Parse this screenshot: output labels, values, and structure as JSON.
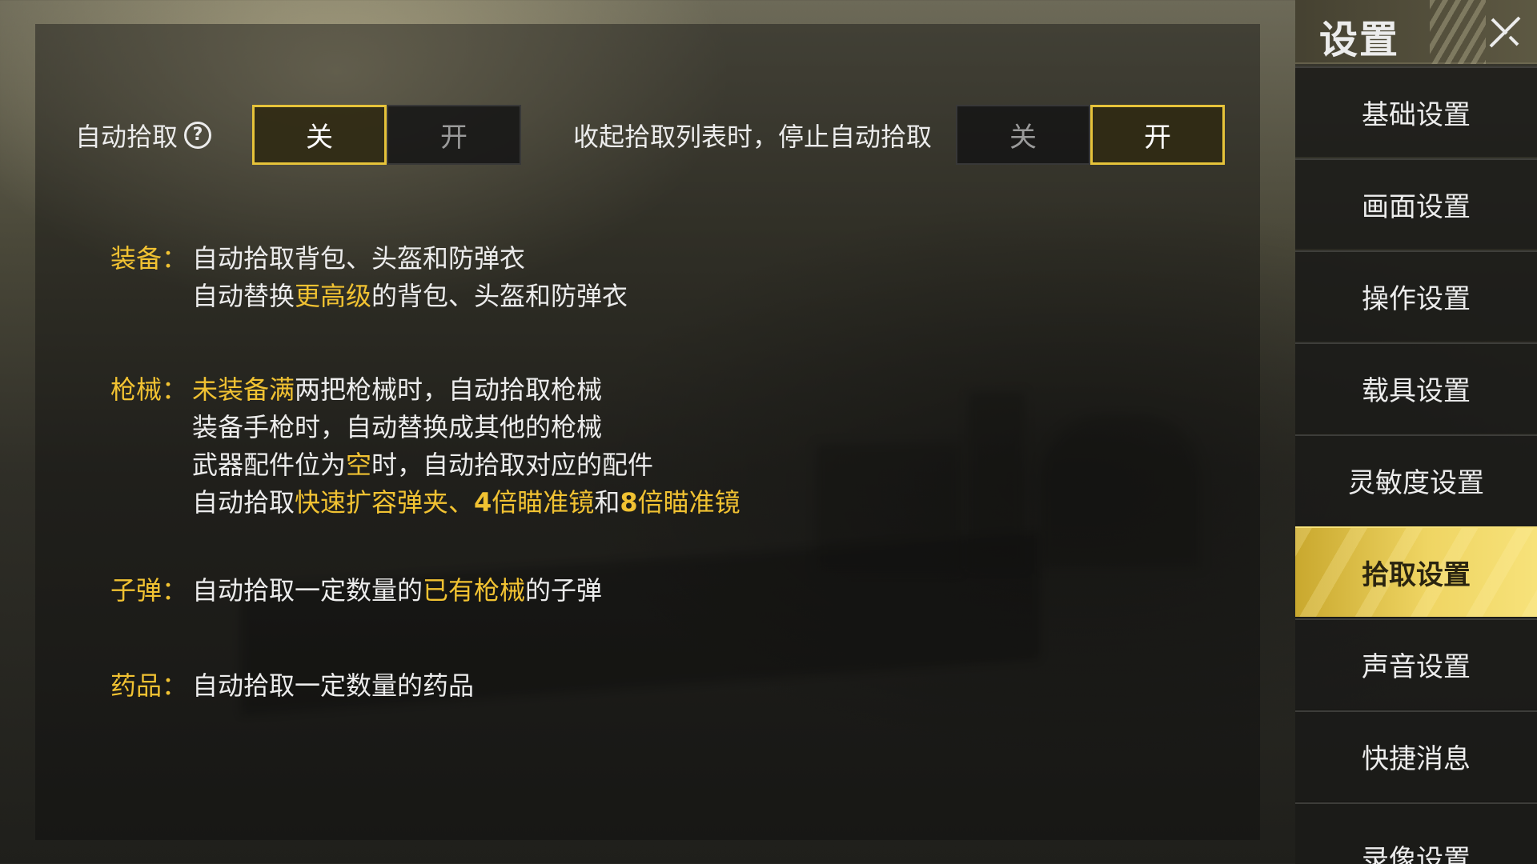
{
  "top_toggles": {
    "auto_pickup": {
      "label": "自动拾取",
      "help_glyph": "?",
      "options": [
        "关",
        "开"
      ],
      "selected": "关"
    },
    "stop_on_collapse": {
      "label": "收起拾取列表时，停止自动拾取",
      "options": [
        "关",
        "开"
      ],
      "selected": "开"
    }
  },
  "rules": {
    "equipment": {
      "category": "装备：",
      "line1": "自动拾取背包、头盔和防弹衣",
      "line2_a": "自动替换",
      "line2_b": "更高级",
      "line2_c": "的背包、头盔和防弹衣"
    },
    "weapons": {
      "category": "枪械：",
      "line1_a": "未装备满",
      "line1_b": "两把枪械时，自动拾取枪械",
      "line2": "装备手枪时，自动替换成其他的枪械",
      "line3_a": "武器配件位为",
      "line3_b": "空",
      "line3_c": "时，自动拾取对应的配件",
      "line4_a": "自动拾取",
      "line4_b": "快速扩容弹夹、",
      "line4_c": "4",
      "line4_d": "倍瞄准镜",
      "line4_e": "和",
      "line4_f": "8",
      "line4_g": "倍瞄准镜"
    },
    "ammo": {
      "category": "子弹：",
      "line1_a": "自动拾取一定数量的",
      "line1_b": "已有枪械",
      "line1_c": "的子弹"
    },
    "medicine": {
      "category": "药品：",
      "line1": "自动拾取一定数量的药品"
    }
  },
  "sidebar": {
    "title": "设置",
    "items": [
      {
        "label": "基础设置"
      },
      {
        "label": "画面设置"
      },
      {
        "label": "操作设置"
      },
      {
        "label": "载具设置"
      },
      {
        "label": "灵敏度设置"
      },
      {
        "label": "拾取设置"
      },
      {
        "label": "声音设置"
      },
      {
        "label": "快捷消息"
      },
      {
        "label": "录像设置"
      }
    ],
    "active_item": "拾取设置"
  },
  "colors": {
    "accent": "#f1c232",
    "active_border": "#e6c33a",
    "active_tab": "#efd563"
  },
  "icons": {
    "help": "help-circle-icon",
    "close": "close-x-icon"
  }
}
